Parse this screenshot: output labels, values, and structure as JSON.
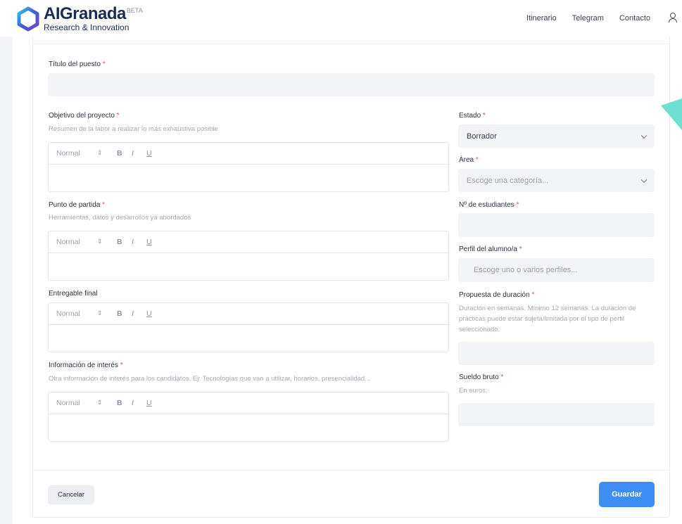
{
  "header": {
    "logo_title_bold": "AI",
    "logo_title_rest": "Granada",
    "logo_beta": "BETA",
    "logo_subtitle": "Research & Innovation",
    "nav": [
      "Itinerario",
      "Telegram",
      "Contacto"
    ]
  },
  "form": {
    "titulo": {
      "label": "Título del puesto",
      "required": "*",
      "value": ""
    },
    "objetivo": {
      "label": "Objetivo del proyecto",
      "required": "*",
      "hint": "Resumen de la labor a realizar lo más exhaustiva posible"
    },
    "punto_partida": {
      "label": "Punto de partida",
      "required": "*",
      "hint": "Herramientas, datos y desarrollos ya abordados"
    },
    "entregable": {
      "label": "Entregable final"
    },
    "informacion": {
      "label": "Información de interés",
      "required": "*",
      "hint": "Otra información de interés para los candidatos. Ej: Tecnologías que van a utilizar, horarios, presencialidad..."
    },
    "estado": {
      "label": "Estado",
      "required": "*",
      "value": "Borrador"
    },
    "area": {
      "label": "Área",
      "required": "*",
      "placeholder": "Escoge una categoría..."
    },
    "estudiantes": {
      "label": "Nº de estudiantes",
      "required": "*",
      "value": ""
    },
    "perfil": {
      "label": "Perfil del alumno/a",
      "required": "*",
      "placeholder": "Escoge uno o varios perfiles..."
    },
    "duracion": {
      "label": "Propuesta de duración",
      "required": "*",
      "hint": "Duración en semanas. Mínimo 12 semanas. La duración de prácticas puede estar sujeta/limitada por el tipo de perfil seleccionado.",
      "value": ""
    },
    "sueldo": {
      "label": "Sueldo bruto",
      "required": "*",
      "hint": "En euros.",
      "value": ""
    }
  },
  "editor_toolbar": {
    "format": "Normal",
    "arrows": "⇕",
    "bold": "B",
    "italic": "I",
    "underline": "U"
  },
  "buttons": {
    "cancel": "Cancelar",
    "save": "Guardar"
  },
  "colors": {
    "primary": "#3a8ef6",
    "required": "#e55353",
    "accent_decor": "#6ee0cf"
  }
}
